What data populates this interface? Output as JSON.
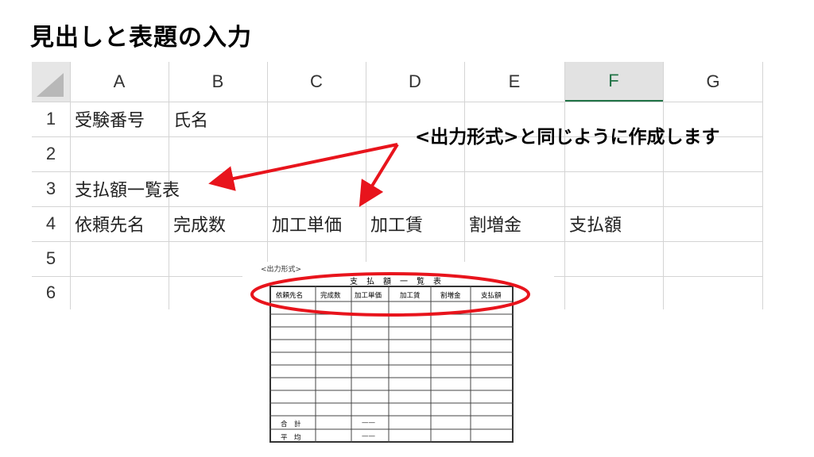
{
  "slide": {
    "title": "見出しと表題の入力"
  },
  "sheet": {
    "columns": [
      "A",
      "B",
      "C",
      "D",
      "E",
      "F",
      "G"
    ],
    "rows": [
      "1",
      "2",
      "3",
      "4",
      "5",
      "6"
    ],
    "active_column": "F",
    "cells": {
      "A1": "受験番号",
      "B1": "氏名",
      "A3": "支払額一覧表",
      "A4": "依頼先名",
      "B4": "完成数",
      "C4": "加工単価",
      "D4": "加工賃",
      "E4": "割増金",
      "F4": "支払額"
    }
  },
  "annotation": {
    "text": "<出力形式>と同じように作成します",
    "color": "#e8141c"
  },
  "form": {
    "caption": "<出力形式>",
    "title": "支払額一覧表",
    "headers": [
      "依頼先名",
      "完成数",
      "加工単価",
      "加工賃",
      "割増金",
      "支払額"
    ],
    "footer": {
      "total_label": "合　計",
      "avg_label": "平　均",
      "dash": "——"
    }
  },
  "colors": {
    "accent_red": "#e8141c",
    "excel_green": "#217346",
    "grid": "#d4d4d4"
  }
}
